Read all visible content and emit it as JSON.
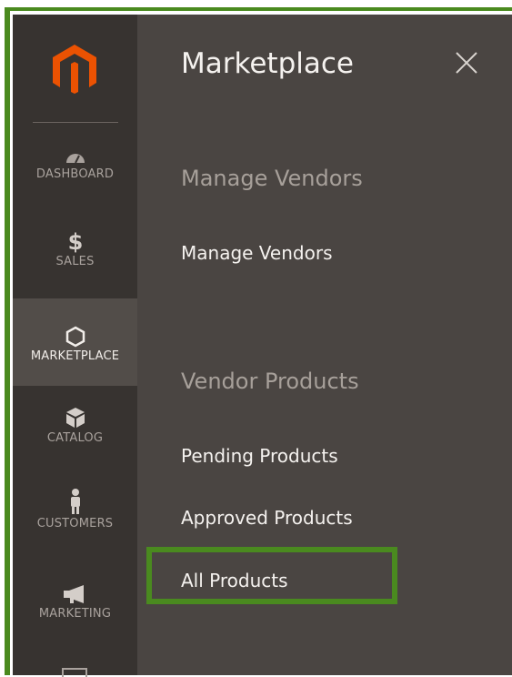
{
  "sidebar": {
    "logo": "magento-logo",
    "items": [
      {
        "label": "DASHBOARD",
        "icon": "dashboard-icon",
        "active": false
      },
      {
        "label": "SALES",
        "icon": "dollar-icon",
        "active": false
      },
      {
        "label": "MARKETPLACE",
        "icon": "hexagon-icon",
        "active": true
      },
      {
        "label": "CATALOG",
        "icon": "box-icon",
        "active": false
      },
      {
        "label": "CUSTOMERS",
        "icon": "person-icon",
        "active": false
      },
      {
        "label": "MARKETING",
        "icon": "megaphone-icon",
        "active": false
      }
    ]
  },
  "panel": {
    "title": "Marketplace",
    "sections": [
      {
        "title": "Manage Vendors",
        "links": [
          "Manage Vendors"
        ]
      },
      {
        "title": "Vendor Products",
        "links": [
          "Pending Products",
          "Approved Products",
          "All Products"
        ]
      }
    ]
  },
  "colors": {
    "accent_green": "#4a8a1f",
    "sidebar_bg": "#373330",
    "panel_bg": "#4a4542",
    "logo_orange": "#eb5202"
  }
}
